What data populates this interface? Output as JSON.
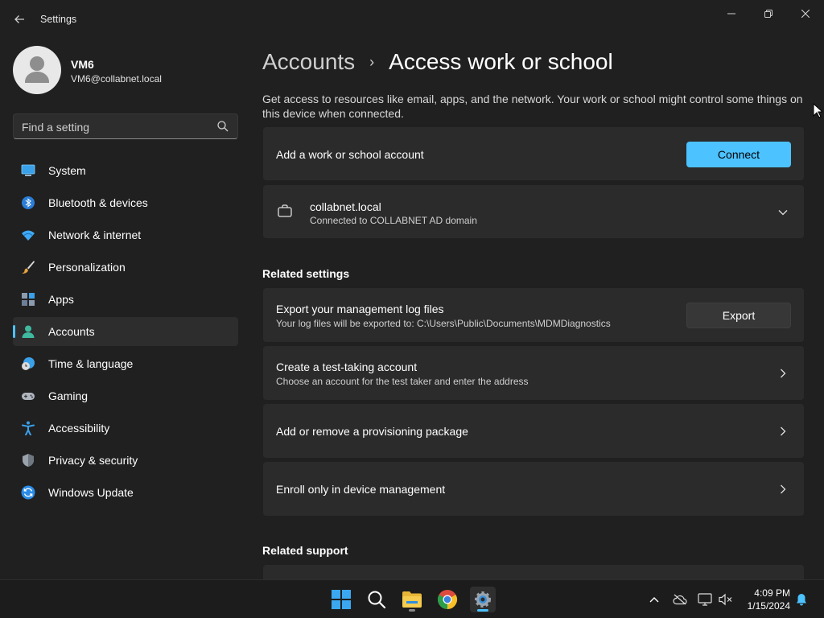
{
  "window": {
    "app_title": "Settings"
  },
  "profile": {
    "name": "VM6",
    "email": "VM6@collabnet.local"
  },
  "search": {
    "placeholder": "Find a setting"
  },
  "sidebar": {
    "items": [
      {
        "label": "System",
        "icon": "system-icon"
      },
      {
        "label": "Bluetooth & devices",
        "icon": "bluetooth-icon"
      },
      {
        "label": "Network & internet",
        "icon": "wifi-icon"
      },
      {
        "label": "Personalization",
        "icon": "brush-icon"
      },
      {
        "label": "Apps",
        "icon": "apps-icon"
      },
      {
        "label": "Accounts",
        "icon": "accounts-icon",
        "active": true
      },
      {
        "label": "Time & language",
        "icon": "globe-clock-icon"
      },
      {
        "label": "Gaming",
        "icon": "gamepad-icon"
      },
      {
        "label": "Accessibility",
        "icon": "accessibility-icon"
      },
      {
        "label": "Privacy & security",
        "icon": "shield-icon"
      },
      {
        "label": "Windows Update",
        "icon": "update-icon"
      }
    ]
  },
  "breadcrumb": {
    "parent": "Accounts",
    "separator": "›",
    "current": "Access work or school"
  },
  "description": "Get access to resources like email, apps, and the network. Your work or school might control some things on this device when connected.",
  "add_account": {
    "title": "Add a work or school account",
    "button": "Connect"
  },
  "connected_account": {
    "title": "collabnet.local",
    "subtitle": "Connected to COLLABNET AD domain"
  },
  "related_settings": {
    "heading": "Related settings",
    "export": {
      "title": "Export your management log files",
      "subtitle": "Your log files will be exported to: C:\\Users\\Public\\Documents\\MDMDiagnostics",
      "button": "Export"
    },
    "test_account": {
      "title": "Create a test-taking account",
      "subtitle": "Choose an account for the test taker and enter the address"
    },
    "provisioning": {
      "title": "Add or remove a provisioning package"
    },
    "enroll": {
      "title": "Enroll only in device management"
    }
  },
  "related_support": {
    "heading": "Related support"
  },
  "taskbar": {
    "time": "4:09 PM",
    "date": "1/15/2024"
  },
  "colors": {
    "accent": "#4cc2ff",
    "background": "#202020",
    "card": "#2b2b2b"
  }
}
